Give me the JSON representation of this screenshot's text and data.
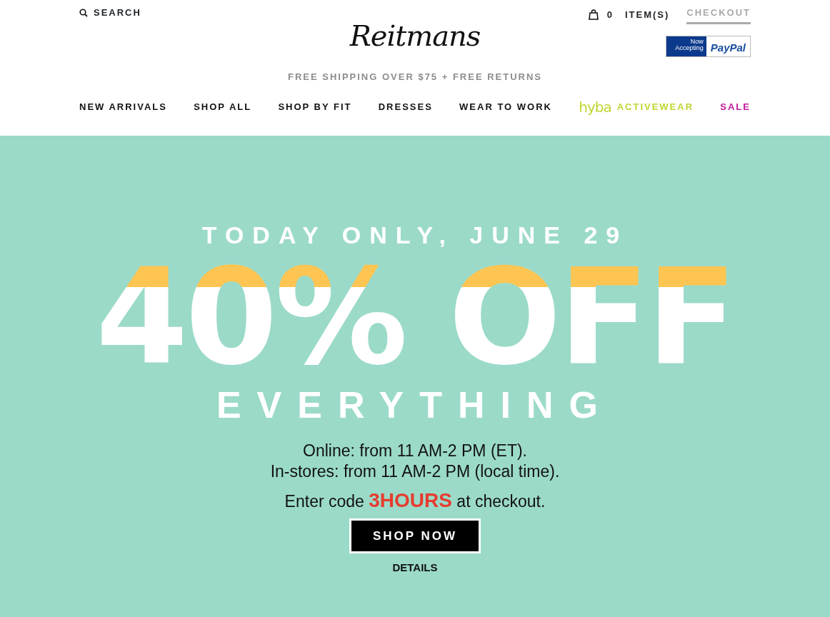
{
  "header": {
    "search": "SEARCH",
    "cart": {
      "count": "0",
      "label": "ITEM(S)"
    },
    "checkout": "CHECKOUT",
    "logo": "Reitmans",
    "paypal": {
      "note": "Now Accepting",
      "brand": "PayPal"
    },
    "shipping": "FREE SHIPPING OVER $75 + FREE RETURNS"
  },
  "nav": [
    {
      "label": "NEW ARRIVALS",
      "color": "#111111"
    },
    {
      "label": "SHOP ALL",
      "color": "#111111"
    },
    {
      "label": "SHOP BY FIT",
      "color": "#111111"
    },
    {
      "label": "DRESSES",
      "color": "#111111"
    },
    {
      "label": "WEAR TO WORK",
      "color": "#111111"
    },
    {
      "brand": "hyba",
      "label": "ACTIVEWEAR",
      "color": "#c3d531"
    },
    {
      "label": "SALE",
      "color": "#c2189b"
    }
  ],
  "hero": {
    "eyebrow": "TODAY ONLY, JUNE 29",
    "headline": "40% OFF",
    "subhead": "EVERYTHING",
    "lines": [
      "Online: from 11 AM-2 PM (ET).",
      "In-stores: from 11 AM-2 PM (local time)."
    ],
    "code": {
      "prefix": "Enter code",
      "code": "3HOURS",
      "suffix": "at checkout."
    },
    "button": "SHOP NOW",
    "details": "DETAILS"
  }
}
